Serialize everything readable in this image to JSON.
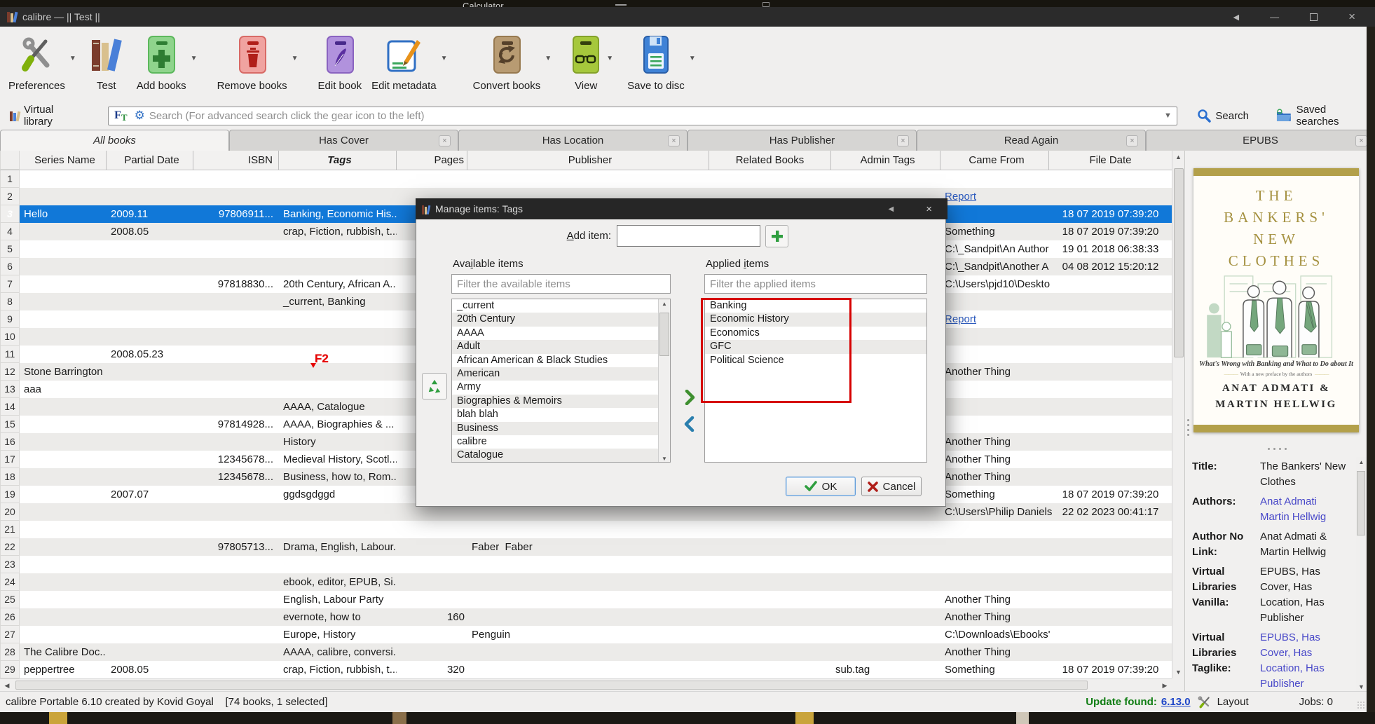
{
  "desktop": {
    "background_window_title": "Calculator"
  },
  "window": {
    "title": "calibre — || Test ||"
  },
  "toolbar": {
    "buttons": [
      {
        "label": "Preferences",
        "icon": "tools-icon",
        "dropdown": true
      },
      {
        "label": "Test",
        "icon": "library-books-icon",
        "dropdown": false
      },
      {
        "label": "Add books",
        "icon": "add-book-icon",
        "dropdown": true
      },
      {
        "label": "Remove books",
        "icon": "remove-book-icon",
        "dropdown": true
      },
      {
        "label": "Edit book",
        "icon": "edit-book-icon",
        "dropdown": false
      },
      {
        "label": "Edit metadata",
        "icon": "edit-metadata-icon",
        "dropdown": true
      },
      {
        "label": "Convert books",
        "icon": "convert-books-icon",
        "dropdown": true
      },
      {
        "label": "View",
        "icon": "view-book-icon",
        "dropdown": true
      },
      {
        "label": "Save to disc",
        "icon": "save-disc-icon",
        "dropdown": true
      }
    ]
  },
  "search": {
    "virtual_library_label": "Virtual library",
    "placeholder": "Search (For advanced search click the gear icon to the left)",
    "search_button": "Search",
    "saved_searches_button": "Saved searches"
  },
  "tabs": [
    {
      "label": "All books",
      "active": true,
      "closable": false
    },
    {
      "label": "Has Cover",
      "active": false,
      "closable": true
    },
    {
      "label": "Has Location",
      "active": false,
      "closable": true
    },
    {
      "label": "Has Publisher",
      "active": false,
      "closable": true
    },
    {
      "label": "Read Again",
      "active": false,
      "closable": true
    },
    {
      "label": "EPUBS",
      "active": false,
      "closable": true
    }
  ],
  "table": {
    "columns": [
      "Series Name",
      "Partial Date",
      "ISBN",
      "Tags",
      "Pages",
      "Publisher",
      "Related Books",
      "Admin Tags",
      "Came From",
      "File Date"
    ],
    "sort_column": "Tags",
    "rows": [
      {
        "n": 1
      },
      {
        "n": 2,
        "came": "Report",
        "link": true
      },
      {
        "n": 3,
        "series": "Hello",
        "pdate": "2009.11",
        "isbn": "97806911...",
        "tags": "Banking, Economic His...",
        "fdate": "18 07 2019 07:39:20",
        "sel": true
      },
      {
        "n": 4,
        "pdate": "2008.05",
        "tags": "crap, Fiction, rubbish, t...",
        "came": "Something",
        "fdate": "18 07 2019 07:39:20"
      },
      {
        "n": 5,
        "came": "C:\\_Sandpit\\An Author",
        "fdate": "19 01 2018 06:38:33"
      },
      {
        "n": 6,
        "came": "C:\\_Sandpit\\Another A",
        "fdate": "04 08 2012 15:20:12"
      },
      {
        "n": 7,
        "isbn": "97818830...",
        "tags": "20th Century, African A...",
        "came": "C:\\Users\\pjd10\\Deskto"
      },
      {
        "n": 8,
        "tags": "_current, Banking"
      },
      {
        "n": 9,
        "came": "Report",
        "link": true
      },
      {
        "n": 10
      },
      {
        "n": 11,
        "pdate": "2008.05.23"
      },
      {
        "n": 12,
        "series": "Stone Barrington",
        "came": "Another Thing"
      },
      {
        "n": 13,
        "series": "aaa"
      },
      {
        "n": 14,
        "tags": "AAAA, Catalogue"
      },
      {
        "n": 15,
        "isbn": "97814928...",
        "tags": "AAAA, Biographies & ..."
      },
      {
        "n": 16,
        "tags": "History",
        "came": "Another Thing"
      },
      {
        "n": 17,
        "isbn": "12345678...",
        "tags": "Medieval History, Scotl...",
        "came": "Another Thing"
      },
      {
        "n": 18,
        "isbn": "12345678...",
        "tags": "Business, how to, Rom...",
        "came": "Another Thing"
      },
      {
        "n": 19,
        "pdate": "2007.07",
        "tags": "ggdsgdggd",
        "came": "Something",
        "fdate": "18 07 2019 07:39:20"
      },
      {
        "n": 20,
        "came": "C:\\Users\\Philip Daniels",
        "fdate": "22 02 2023 00:41:17"
      },
      {
        "n": 21
      },
      {
        "n": 22,
        "isbn": "97805713...",
        "tags": "Drama, English, Labour...",
        "pub": "Faber  Faber"
      },
      {
        "n": 23
      },
      {
        "n": 24,
        "tags": "ebook, editor, EPUB, Si..."
      },
      {
        "n": 25,
        "tags": "English, Labour Party",
        "came": "Another Thing"
      },
      {
        "n": 26,
        "tags": "evernote, how to",
        "pages": "160",
        "came": "Another Thing"
      },
      {
        "n": 27,
        "tags": "Europe, History",
        "pub": "Penguin",
        "came": "C:\\Downloads\\Ebooks'"
      },
      {
        "n": 28,
        "series": "The Calibre Doc...",
        "tags": "AAAA, calibre, conversi...",
        "came": "Another Thing"
      },
      {
        "n": 29,
        "series": "peppertree",
        "pdate": "2008.05",
        "tags": "crap, Fiction, rubbish, t...",
        "pages": "320",
        "admin": "sub.tag",
        "came": "Something",
        "fdate": "18 07 2019 07:39:20"
      }
    ]
  },
  "annotation": {
    "label": "F2",
    "color": "#e50505"
  },
  "dialog": {
    "title": "Manage items: Tags",
    "add_item_label": "Add item:",
    "available_label": "Available items",
    "applied_label": "Applied items",
    "available_filter_placeholder": "Filter the available items",
    "applied_filter_placeholder": "Filter the applied items",
    "available_items": [
      "_current",
      "20th Century",
      "AAAA",
      "Adult",
      "African American & Black Studies",
      "American",
      "Army",
      "Biographies & Memoirs",
      "blah blah",
      "Business",
      "calibre",
      "Catalogue"
    ],
    "applied_items": [
      "Banking",
      "Economic History",
      "Economics",
      "GFC",
      "Political Science"
    ],
    "ok_label": "OK",
    "cancel_label": "Cancel"
  },
  "book_panel": {
    "cover": {
      "title_lines": [
        "THE",
        "BANKERS'",
        "NEW",
        "CLOTHES"
      ],
      "subtitle": "What's Wrong with Banking and What to Do about It",
      "preface_note": "With a new preface by the authors",
      "author_lines": [
        "ANAT ADMATI &",
        "MARTIN HELLWIG"
      ]
    },
    "fields": {
      "title_label": "Title:",
      "title_value": "The Bankers' New Clothes",
      "authors_label": "Authors:",
      "authors_links": [
        "Anat Admati",
        "Martin Hellwig"
      ],
      "author_no_link_label": "Author No Link:",
      "author_no_link_value": "Anat Admati & Martin Hellwig",
      "vl_vanilla_label": "Virtual Libraries Vanilla:",
      "vl_vanilla_value": "EPUBS, Has Cover, Has Location, Has Publisher",
      "vl_taglike_label": "Virtual Libraries Taglike:",
      "vl_taglike_value": "EPUBS, Has Cover, Has Location, Has Publisher"
    }
  },
  "statusbar": {
    "left": "calibre Portable 6.10 created by Kovid Goyal    [74 books, 1 selected]",
    "update_label": "Update found:",
    "update_version": "6.13.0",
    "layout_label": "Layout",
    "jobs_label": "Jobs: 0"
  },
  "colors": {
    "selection_blue": "#1178d8",
    "link_blue": "#2d5bbe",
    "panel_link": "#4747c8",
    "annotation_red": "#e50505",
    "update_green": "#0f7d12",
    "cover_gold": "#b3a04a"
  }
}
